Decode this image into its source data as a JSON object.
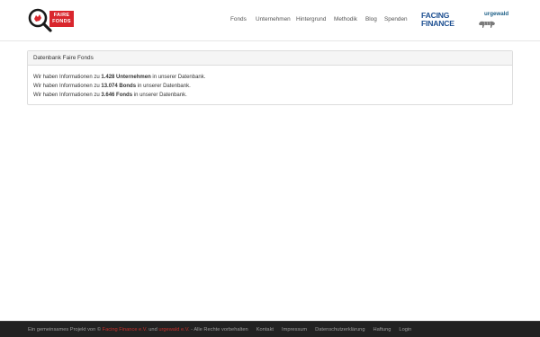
{
  "brand": {
    "flag_line1": "FAIRE",
    "flag_line2": "FONDS"
  },
  "nav": {
    "items": [
      {
        "label": "Fonds"
      },
      {
        "label": "Unternehmen"
      },
      {
        "label": "Hintergrund"
      },
      {
        "label": "Methodik"
      },
      {
        "label": "Blog"
      },
      {
        "label": "Spenden"
      }
    ]
  },
  "partners": {
    "facing_finance_line1": "FACING",
    "facing_finance_line2": "FINANCE",
    "urgewald": "urgewald"
  },
  "panel": {
    "title": "Datenbank Faire Fonds",
    "lines": [
      {
        "prefix": "Wir haben Informationen zu ",
        "bold": "1.428 Unternehmen",
        "suffix": " in unserer Datenbank."
      },
      {
        "prefix": "Wir haben Informationen zu ",
        "bold": "13.074 Bonds",
        "suffix": " in unserer Datenbank."
      },
      {
        "prefix": "Wir haben Informationen zu ",
        "bold": "3.646 Fonds",
        "suffix": " in unserer Datenbank."
      }
    ]
  },
  "footer": {
    "prefix": "Ein gemeinsames Projekt von © ",
    "partner1": "Facing Finance e.V.",
    "and": " und ",
    "partner2": "urgewald e.V.",
    "rights": " - Alle Rechte vorbehalten",
    "links": [
      {
        "label": "Kontakt"
      },
      {
        "label": "Impressum"
      },
      {
        "label": "Datenschutzerklärung"
      },
      {
        "label": "Haftung"
      },
      {
        "label": "Login"
      }
    ]
  },
  "colors": {
    "brand_red": "#d9262d",
    "facing_finance_blue": "#1d4f91",
    "footer_bg": "#222222"
  }
}
